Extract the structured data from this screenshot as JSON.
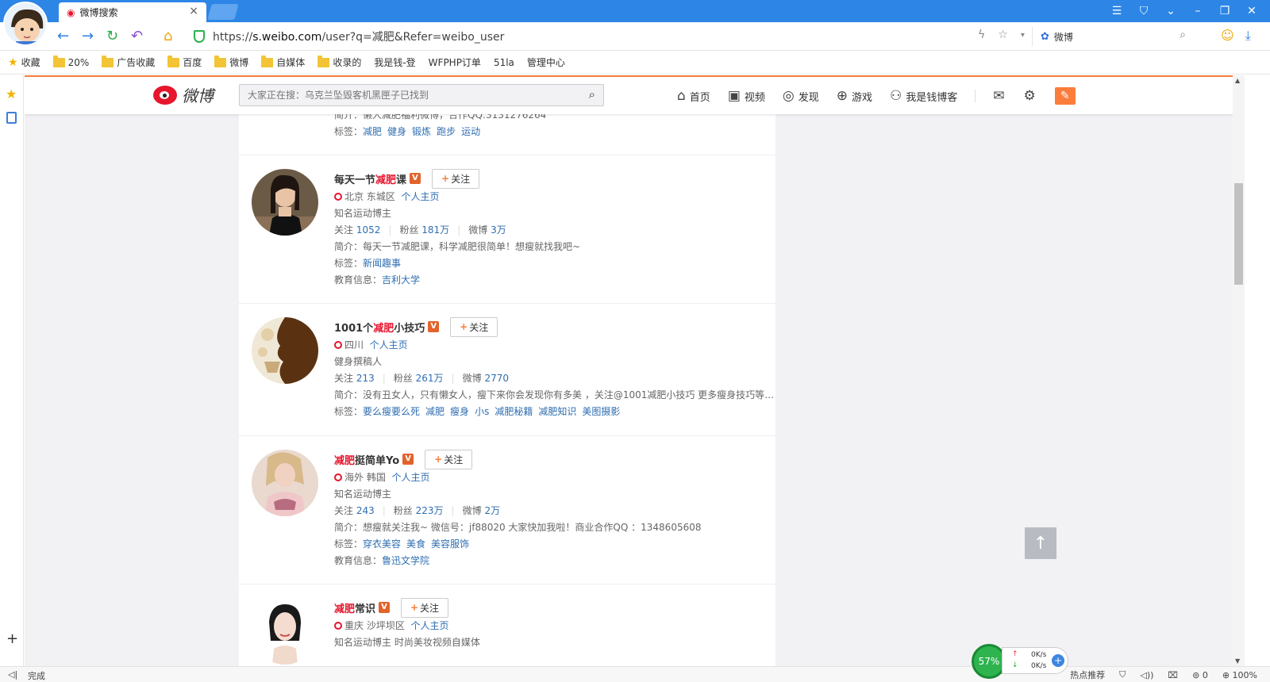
{
  "browser": {
    "tab_title": "微博搜索",
    "url_prefix": "https://",
    "url_host": "s.weibo.com",
    "url_path": "/user?q=减肥&Refer=weibo_user",
    "search_engine_text": "微博",
    "status_text": "完成",
    "status_recommend": "热点推荐",
    "status_downloads": "0",
    "status_zoom": "100%",
    "net_percent": "57%",
    "net_up": "0K/s",
    "net_down": "0K/s"
  },
  "bookmarks": [
    {
      "label": "收藏",
      "icon": "star-icon"
    },
    {
      "label": "20%",
      "icon": "folder-icon"
    },
    {
      "label": "广告收藏",
      "icon": "folder-icon"
    },
    {
      "label": "百度",
      "icon": "folder-icon"
    },
    {
      "label": "微博",
      "icon": "folder-icon"
    },
    {
      "label": "自媒体",
      "icon": "folder-icon"
    },
    {
      "label": "收录的",
      "icon": "folder-icon"
    },
    {
      "label": "我是钱-登",
      "icon": "page-icon"
    },
    {
      "label": "WFPHP订单",
      "icon": "page-icon"
    },
    {
      "label": "51la",
      "icon": "page-icon"
    },
    {
      "label": "管理中心",
      "icon": "page-icon"
    }
  ],
  "weibo": {
    "logo_text": "微博",
    "search_placeholder": "大家正在搜：乌克兰坠毁客机黑匣子已找到",
    "nav": {
      "home": "首页",
      "video": "视频",
      "discover": "发现",
      "game": "游戏",
      "profile": "我是钱博客"
    }
  },
  "top_fragment": {
    "intro_label": "简介：",
    "intro": "懒人减肥福利微博，合作QQ:3131276264",
    "tags_label": "标签：",
    "tags": [
      "减肥",
      "健身",
      "锻炼",
      "跑步",
      "运动"
    ]
  },
  "labels": {
    "follow": "关注",
    "homepage": "个人主页",
    "following": "关注",
    "fans": "粉丝",
    "weibo": "微博",
    "intro": "简介：",
    "tags": "标签：",
    "edu": "教育信息："
  },
  "users": [
    {
      "name_pre": "每天一节",
      "name_hl": "减肥",
      "name_post": "课",
      "location": "北京 东城区",
      "desc": "知名运动博主",
      "following": "1052",
      "fans": "181万",
      "weibo": "3万",
      "intro": "每天一节减肥课，科学减肥很简单！想瘦就找我吧~",
      "tags": [
        "新闻趣事"
      ],
      "edu": "吉利大学"
    },
    {
      "name_pre": "1001个",
      "name_hl": "减肥",
      "name_post": "小技巧",
      "location": "四川",
      "desc": "健身撰稿人",
      "following": "213",
      "fans": "261万",
      "weibo": "2770",
      "intro": "没有丑女人，只有懒女人，瘦下来你会发现你有多美 ，关注@1001减肥小技巧 更多瘦身技巧等…",
      "tags": [
        "要么瘦要么死",
        "减肥",
        "瘦身",
        "小s",
        "减肥秘籍",
        "减肥知识",
        "美图摄影"
      ],
      "edu": ""
    },
    {
      "name_pre": "",
      "name_hl": "减肥",
      "name_post": "挺简单Yo",
      "location": "海外 韩国",
      "desc": "知名运动博主",
      "following": "243",
      "fans": "223万",
      "weibo": "2万",
      "intro": "想瘦就关注我~ 微信号：jf88020 大家快加我啦！商业合作QQ ：1348605608",
      "tags": [
        "穿衣美容",
        "美食",
        "美容服饰"
      ],
      "edu": "鲁迅文学院"
    },
    {
      "name_pre": "",
      "name_hl": "减肥",
      "name_post": "常识",
      "location": "重庆 沙坪坝区",
      "desc": "知名运动博主 时尚美妆视频自媒体"
    }
  ],
  "colors": {
    "browser_blue": "#2d86e6",
    "weibo_orange": "#fa7d3c",
    "highlight_red": "#e6162d",
    "link_blue": "#2f6eb1"
  }
}
